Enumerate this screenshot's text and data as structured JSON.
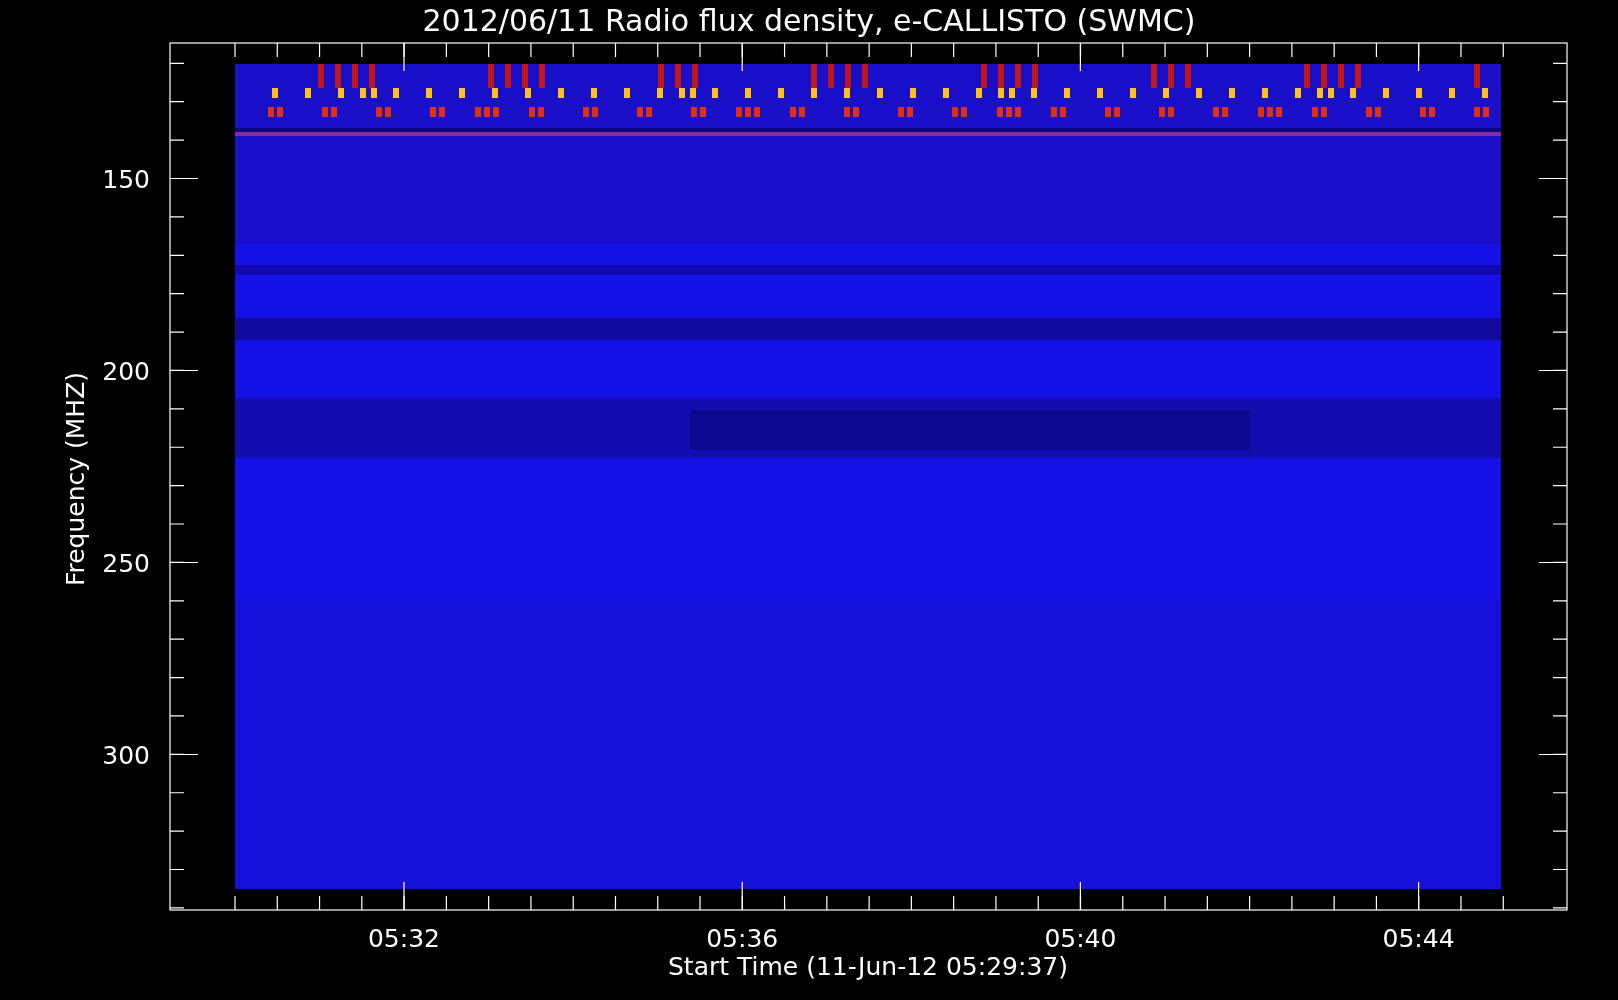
{
  "title": "2012/06/11  Radio flux density, e-CALLISTO (SWMC)",
  "y_axis": {
    "label": "Frequency (MHZ)",
    "ticks": [
      "150",
      "200",
      "250",
      "300"
    ]
  },
  "x_axis": {
    "label": "Start Time (11-Jun-12 05:29:37)",
    "ticks": [
      "05:32",
      "05:36",
      "05:40",
      "05:44"
    ]
  }
}
